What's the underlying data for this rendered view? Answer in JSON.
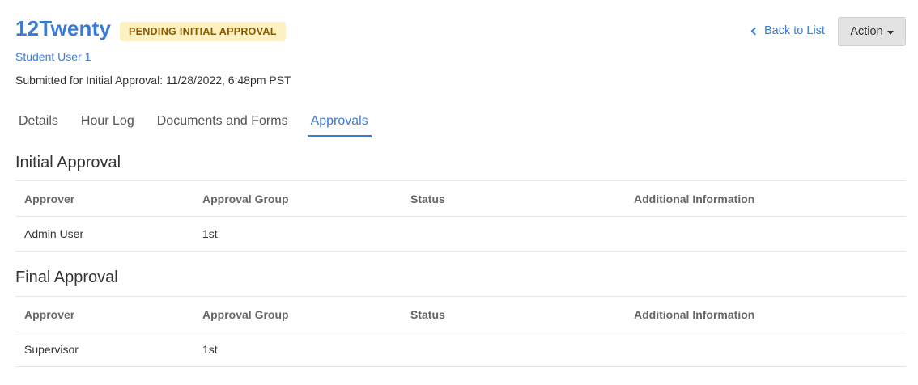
{
  "header": {
    "title": "12Twenty",
    "badge": "PENDING INITIAL APPROVAL",
    "student": "Student User 1",
    "submitted": "Submitted for Initial Approval: 11/28/2022, 6:48pm PST",
    "back_label": "Back to List",
    "action_label": "Action"
  },
  "tabs": [
    {
      "label": "Details"
    },
    {
      "label": "Hour Log"
    },
    {
      "label": "Documents and Forms"
    },
    {
      "label": "Approvals",
      "active": true
    }
  ],
  "columns": [
    "Approver",
    "Approval Group",
    "Status",
    "Additional Information"
  ],
  "sections": [
    {
      "title": "Initial Approval",
      "rows": [
        {
          "approver": "Admin User",
          "group": "1st",
          "status": "",
          "info": ""
        }
      ]
    },
    {
      "title": "Final Approval",
      "rows": [
        {
          "approver": "Supervisor",
          "group": "1st",
          "status": "",
          "info": ""
        }
      ]
    }
  ],
  "colors": {
    "accent": "#3b7bd4",
    "badge_bg": "#fdf0c3",
    "badge_text": "#8a5a00"
  }
}
